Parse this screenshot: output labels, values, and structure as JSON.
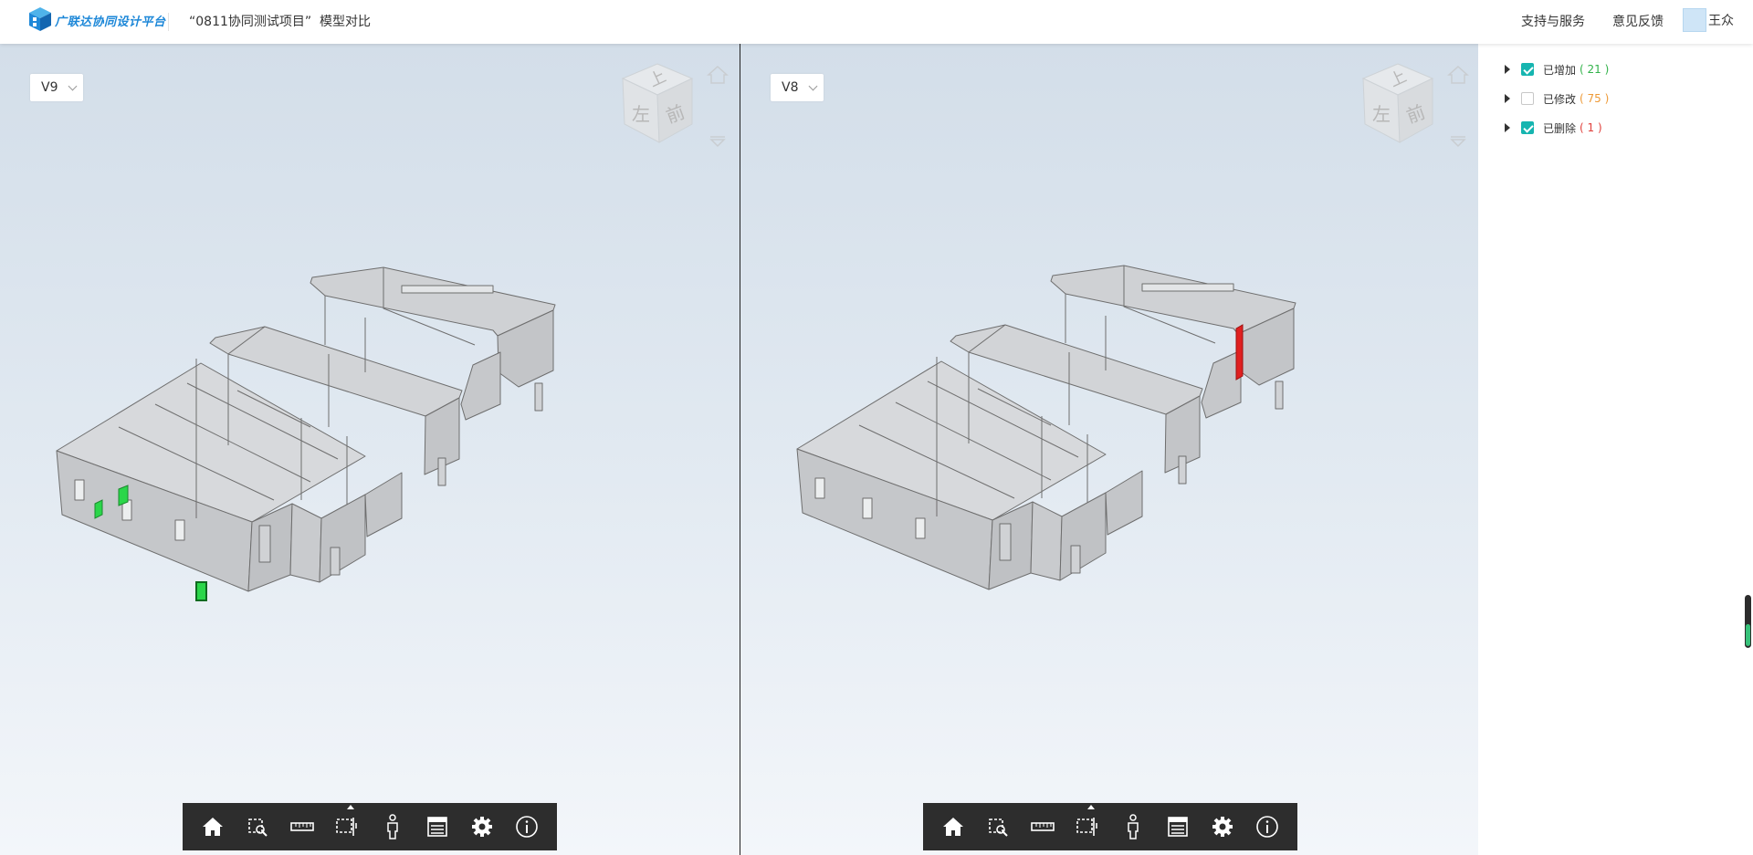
{
  "header": {
    "brand": "广联达协同设计平台",
    "project": "“0811协同测试项目”",
    "page_title": "模型对比",
    "links": [
      "支持与服务",
      "意见反馈"
    ],
    "user": "王众"
  },
  "views": [
    {
      "version": "V9",
      "cube_faces": {
        "top": "上",
        "left": "左",
        "front": "前"
      }
    },
    {
      "version": "V8",
      "cube_faces": {
        "top": "上",
        "left": "左",
        "front": "前"
      }
    }
  ],
  "toolbar_icons": [
    "home-icon",
    "zoom-window-icon",
    "measure-ruler-icon",
    "section-box-icon",
    "walkthrough-person-icon",
    "property-list-icon",
    "settings-gear-icon",
    "info-icon"
  ],
  "filters": [
    {
      "label": "已增加",
      "count": "( 21 )",
      "checked": true,
      "color": "#32b24a"
    },
    {
      "label": "已修改",
      "count": "( 75 )",
      "checked": false,
      "color": "#ee9a37"
    },
    {
      "label": "已删除",
      "count": "( 1 )",
      "checked": true,
      "color": "#e0403c"
    }
  ],
  "colors": {
    "brand": "#1e88d8",
    "checkbox": "#16b5b0",
    "added": "#2bd64a",
    "deleted": "#e02020",
    "toolbar": "#2d2d2d"
  }
}
